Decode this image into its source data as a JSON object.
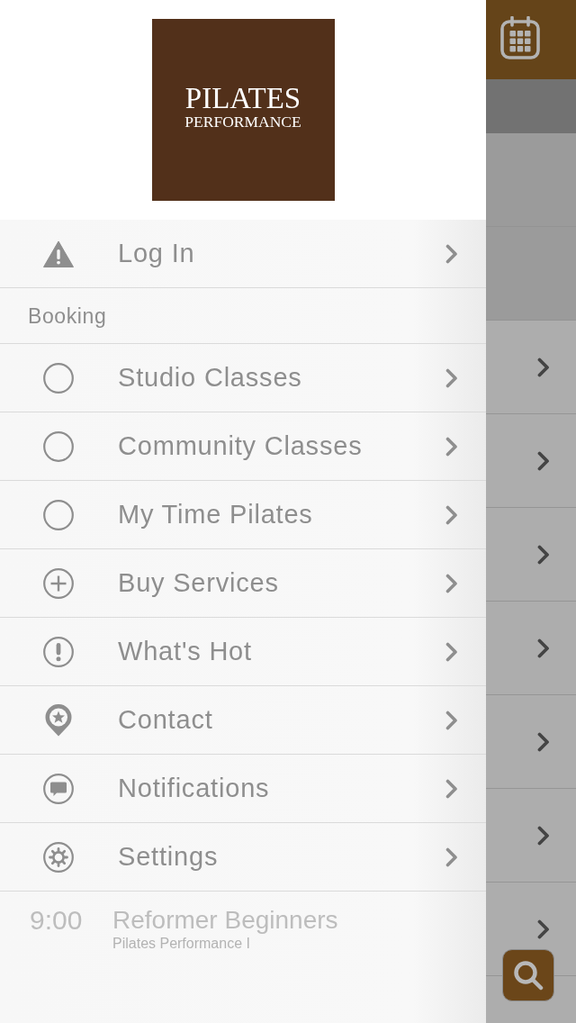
{
  "logo": {
    "title": "PILATES",
    "subtitle": "PERFORMANCE"
  },
  "menu": [
    {
      "kind": "item",
      "label": "Log In"
    },
    {
      "kind": "section",
      "label": "Booking"
    },
    {
      "kind": "item",
      "label": "Studio Classes"
    },
    {
      "kind": "item",
      "label": "Community Classes"
    },
    {
      "kind": "item",
      "label": "My Time Pilates"
    },
    {
      "kind": "item",
      "label": "Buy Services"
    },
    {
      "kind": "item",
      "label": "What's Hot"
    },
    {
      "kind": "item",
      "label": "Contact"
    },
    {
      "kind": "item",
      "label": "Notifications"
    },
    {
      "kind": "item",
      "label": "Settings"
    }
  ],
  "schedule_behind": [
    {
      "time": "9:00",
      "title": "Reformer Beginners",
      "location": "Pilates Performance I"
    }
  ]
}
